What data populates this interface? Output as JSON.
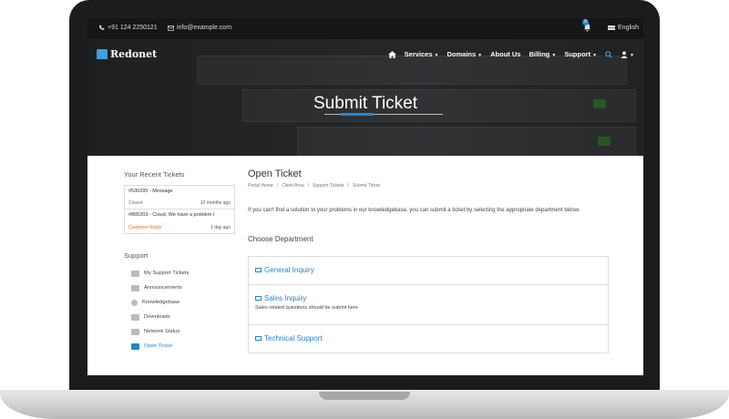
{
  "topbar": {
    "phone": "+91 124 2250121",
    "email": "info@example.com",
    "notifications": "0",
    "language": "English"
  },
  "nav": {
    "brand": "Redonet",
    "items": [
      "Services",
      "Domains",
      "About Us",
      "Billing",
      "Support"
    ]
  },
  "hero": {
    "title": "Submit Ticket"
  },
  "sidebar": {
    "recent_title": "Your Recent Tickets",
    "tickets": [
      {
        "title": "#530295 - Message",
        "status": "Closed",
        "ago": "10 months ago",
        "status_color": "#777777"
      },
      {
        "title": "#865203 - Cloud, We have a problem I",
        "status": "Customer-Reply",
        "ago": "1 day ago",
        "status_color": "#e06c1f"
      }
    ],
    "support_title": "Support",
    "support_items": [
      "My Support Tickets",
      "Announcements",
      "Knowledgebase",
      "Downloads",
      "Network Status",
      "Open Ticket"
    ]
  },
  "main": {
    "title": "Open Ticket",
    "breadcrumb": [
      "Portal Home",
      "Client Area",
      "Support Tickets",
      "Submit Ticket"
    ],
    "description": "If you can't find a solution to your problems in our knowledgebase, you can submit a ticket by selecting the appropriate department below.",
    "choose_label": "Choose Department",
    "departments": [
      {
        "name": "General Inquiry",
        "desc": ""
      },
      {
        "name": "Sales Inquiry",
        "desc": "Sales related questions should be submit here"
      },
      {
        "name": "Technical Support",
        "desc": ""
      }
    ]
  },
  "colors": {
    "accent": "#1e88d4",
    "warning": "#e06c1f",
    "topbar": "#161616"
  }
}
